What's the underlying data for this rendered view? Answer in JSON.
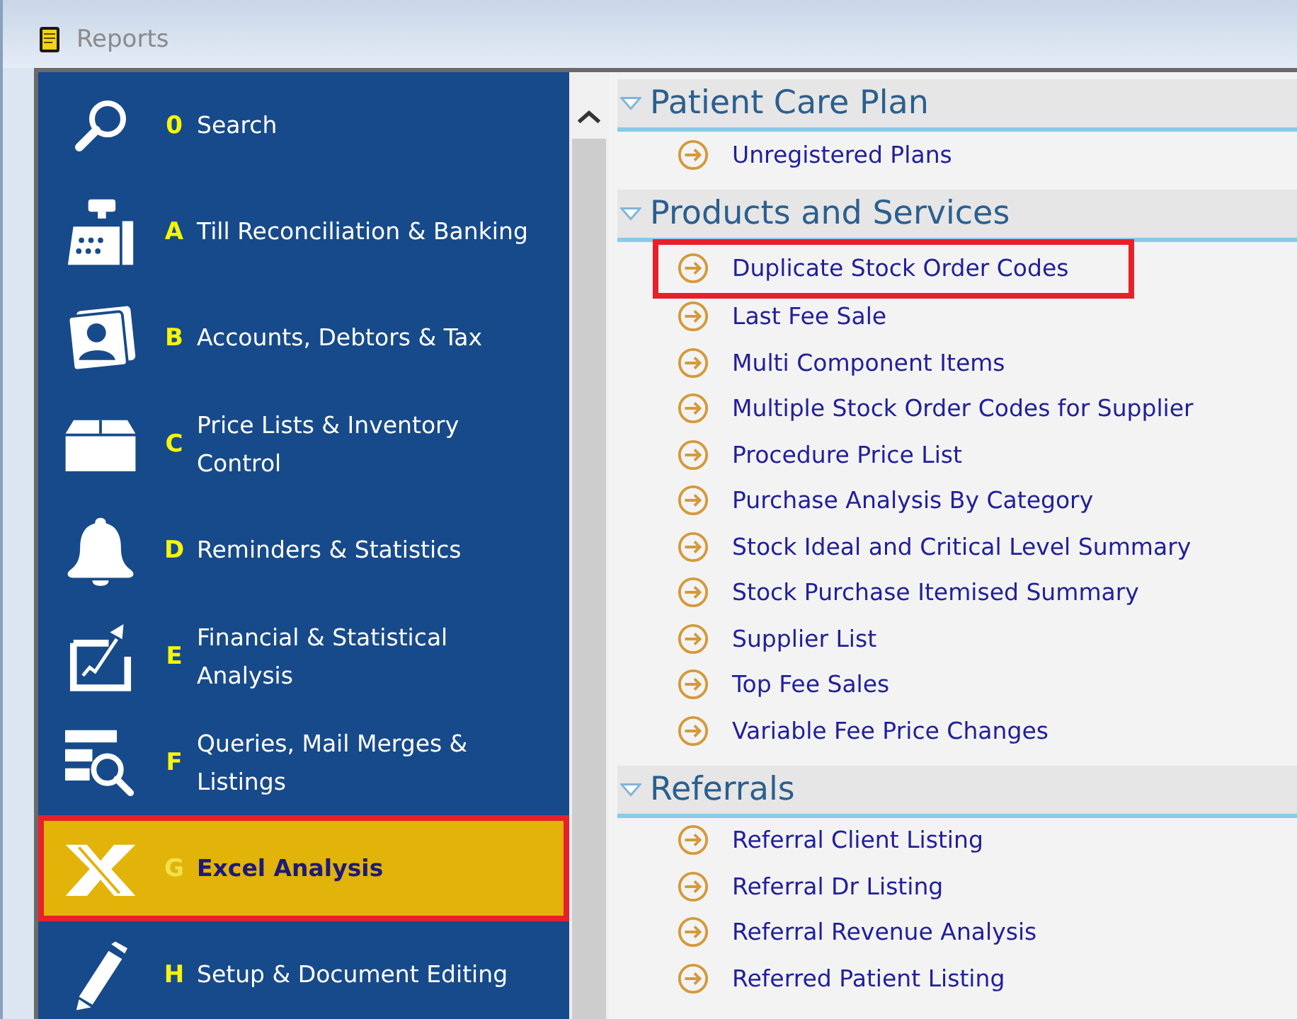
{
  "window": {
    "title": "Reports"
  },
  "sidebar": {
    "items": [
      {
        "key": "0",
        "label": "Search",
        "selected": false,
        "highlighted": false
      },
      {
        "key": "A",
        "label": "Till Reconciliation & Banking",
        "selected": false,
        "highlighted": false
      },
      {
        "key": "B",
        "label": "Accounts, Debtors & Tax",
        "selected": false,
        "highlighted": false
      },
      {
        "key": "C",
        "label": "Price Lists & Inventory Control",
        "selected": false,
        "highlighted": false
      },
      {
        "key": "D",
        "label": "Reminders & Statistics",
        "selected": false,
        "highlighted": false
      },
      {
        "key": "E",
        "label": "Financial & Statistical Analysis",
        "selected": false,
        "highlighted": false
      },
      {
        "key": "F",
        "label": "Queries, Mail Merges & Listings",
        "selected": false,
        "highlighted": false
      },
      {
        "key": "G",
        "label": "Excel Analysis",
        "selected": true,
        "highlighted": true
      },
      {
        "key": "H",
        "label": "Setup & Document Editing",
        "selected": false,
        "highlighted": false
      }
    ]
  },
  "sections": [
    {
      "title": "Patient Care Plan",
      "expanded": true,
      "items": [
        {
          "label": "Unregistered Plans",
          "highlighted": false
        }
      ]
    },
    {
      "title": "Products and Services",
      "expanded": true,
      "items": [
        {
          "label": "Duplicate Stock Order Codes",
          "highlighted": true
        },
        {
          "label": "Last Fee Sale",
          "highlighted": false
        },
        {
          "label": "Multi Component Items",
          "highlighted": false
        },
        {
          "label": "Multiple Stock Order Codes for Supplier",
          "highlighted": false
        },
        {
          "label": "Procedure Price List",
          "highlighted": false
        },
        {
          "label": "Purchase Analysis By Category",
          "highlighted": false
        },
        {
          "label": "Stock Ideal and Critical Level Summary",
          "highlighted": false
        },
        {
          "label": "Stock Purchase Itemised Summary",
          "highlighted": false
        },
        {
          "label": "Supplier List",
          "highlighted": false
        },
        {
          "label": "Top Fee Sales",
          "highlighted": false
        },
        {
          "label": "Variable Fee Price Changes",
          "highlighted": false
        }
      ]
    },
    {
      "title": "Referrals",
      "expanded": true,
      "items": [
        {
          "label": "Referral Client Listing",
          "highlighted": false
        },
        {
          "label": "Referral Dr Listing",
          "highlighted": false
        },
        {
          "label": "Referral Revenue Analysis",
          "highlighted": false
        },
        {
          "label": "Referred Patient Listing",
          "highlighted": false
        }
      ]
    }
  ]
}
